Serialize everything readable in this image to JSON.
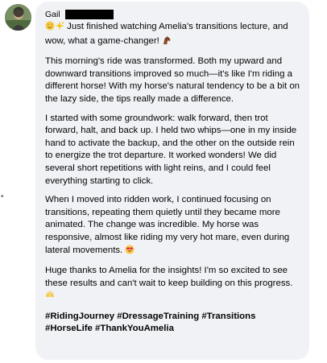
{
  "comment": {
    "author": "Gail",
    "avatar_icon": "user-avatar-photo",
    "intro_icons": [
      "star-face-icon",
      "sparkles-icon"
    ],
    "paragraphs": [
      "Just finished watching Amelia's transitions lecture, and wow, what a game-changer!",
      "This morning's ride was transformed. Both my upward and downward transitions improved so much—it's like I'm riding a different horse! With my horse's natural tendency to be a bit on the lazy side, the tips really made a difference.",
      "I started with some groundwork: walk forward, then trot forward, halt, and back up. I held two whips—one in my inside hand to activate the backup, and the other on the outside rein to energize the trot departure. It worked wonders! We did several short repetitions with light reins, and I could feel everything starting to click.",
      "When I moved into ridden work, I continued focusing on transitions, repeating them quietly until they became more animated. The change was incredible. My horse was responsive, almost like riding my very hot mare, even during lateral movements.",
      "Huge thanks to Amelia for the insights! I'm so excited to see these results and can't wait to keep building on this progress."
    ],
    "hashtags": "#RidingJourney #DressageTraining #Transitions #HorseLife #ThankYouAmelia"
  },
  "colors": {
    "bubble_background": "#f0f2f5",
    "text": "#050505",
    "secondary": "#65676b"
  }
}
